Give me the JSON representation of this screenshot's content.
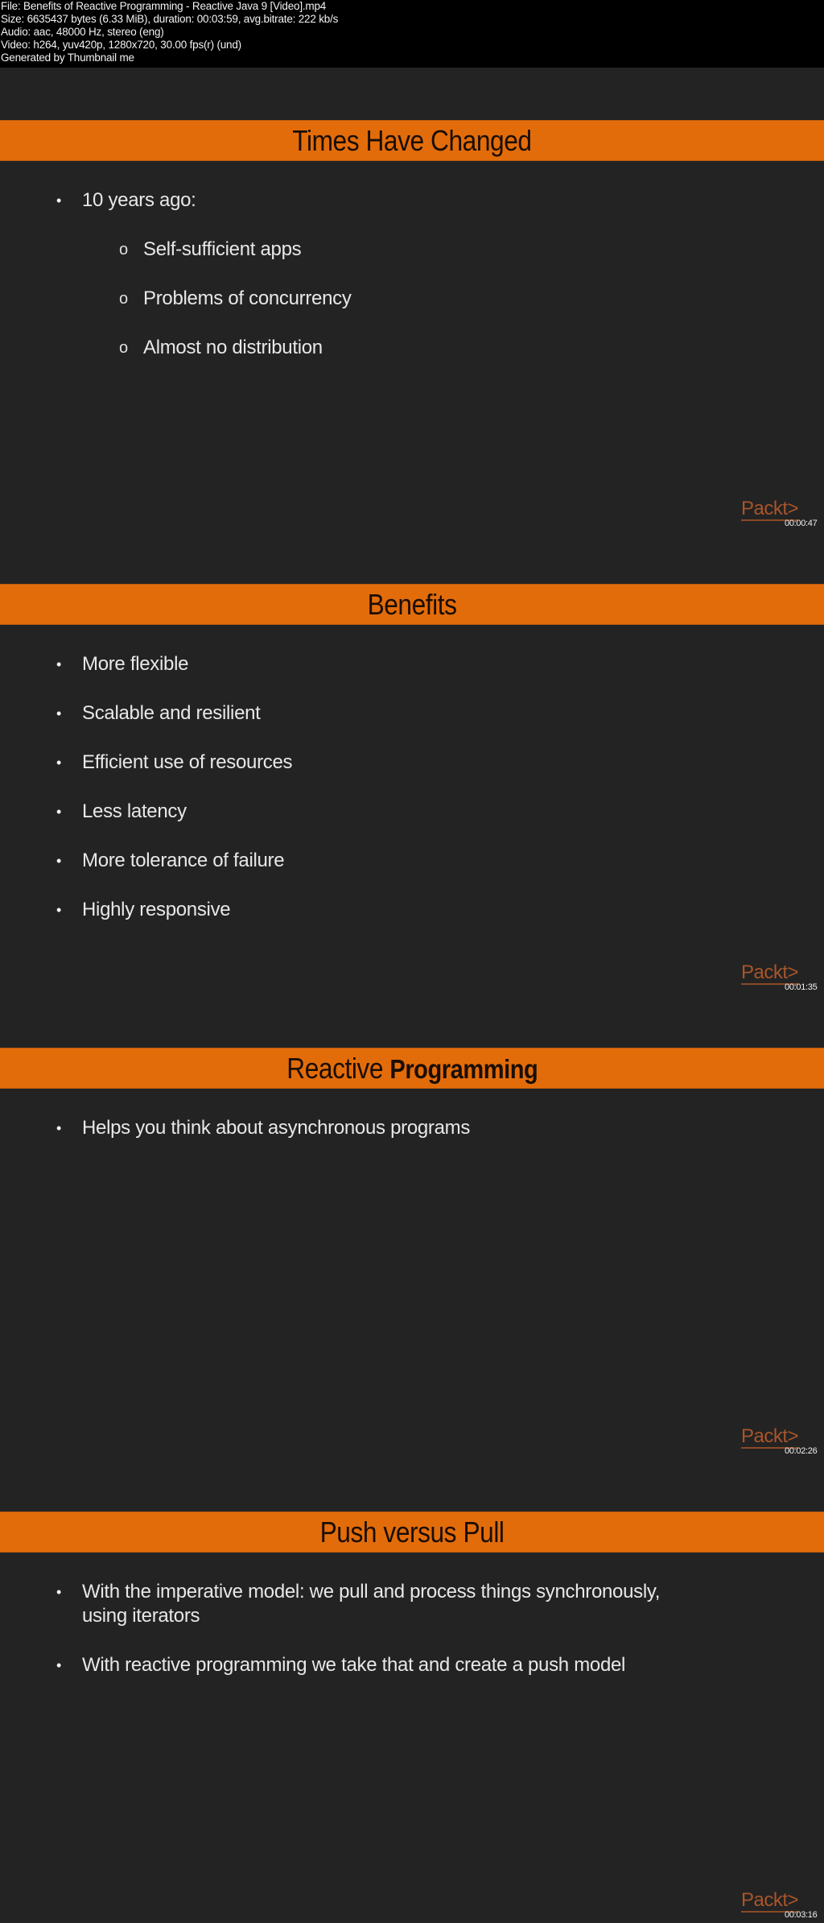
{
  "file_info": {
    "lines": [
      "File: Benefits of Reactive Programming - Reactive Java 9 [Video].mp4",
      "Size: 6635437 bytes (6.33 MiB), duration: 00:03:59, avg.bitrate: 222 kb/s",
      "Audio: aac, 48000 Hz, stereo (eng)",
      "Video: h264, yuv420p, 1280x720, 30.00 fps(r) (und)",
      "Generated by Thumbnail me"
    ]
  },
  "colors": {
    "title_band": "#e36c0a",
    "slide_background": "#232323",
    "body_text": "#e8e8e8",
    "logo": "#a9552a"
  },
  "slides": [
    {
      "title": "Times Have Changed",
      "bullets": [
        {
          "level": 1,
          "marker": "•",
          "text": "10 years ago:"
        },
        {
          "level": 2,
          "marker": "o",
          "text": "Self-sufficient apps"
        },
        {
          "level": 2,
          "marker": "o",
          "text": "Problems of concurrency"
        },
        {
          "level": 2,
          "marker": "o",
          "text": "Almost no distribution"
        }
      ],
      "logo": "Packt>",
      "timestamp": "00:00:47"
    },
    {
      "title": "Benefits",
      "bullets": [
        {
          "level": 1,
          "marker": "•",
          "text": "More flexible"
        },
        {
          "level": 1,
          "marker": "•",
          "text": "Scalable and resilient"
        },
        {
          "level": 1,
          "marker": "•",
          "text": "Efficient use of resources"
        },
        {
          "level": 1,
          "marker": "•",
          "text": "Less latency"
        },
        {
          "level": 1,
          "marker": "•",
          "text": "More tolerance of failure"
        },
        {
          "level": 1,
          "marker": "•",
          "text": "Highly responsive"
        }
      ],
      "logo": "Packt>",
      "timestamp": "00:01:35"
    },
    {
      "title": "Reactive",
      "title_bold": "Programming",
      "bullets": [
        {
          "level": 1,
          "marker": "•",
          "text": "Helps you think about asynchronous programs"
        }
      ],
      "logo": "Packt>",
      "timestamp": "00:02:26"
    },
    {
      "title": "Push versus Pull",
      "bullets": [
        {
          "level": 1,
          "marker": "•",
          "text": "With the imperative model: we pull and process things synchronously, using iterators"
        },
        {
          "level": 1,
          "marker": "•",
          "text": "With reactive programming we take that and create a push model"
        }
      ],
      "logo": "Packt>",
      "timestamp": "00:03:16"
    }
  ]
}
